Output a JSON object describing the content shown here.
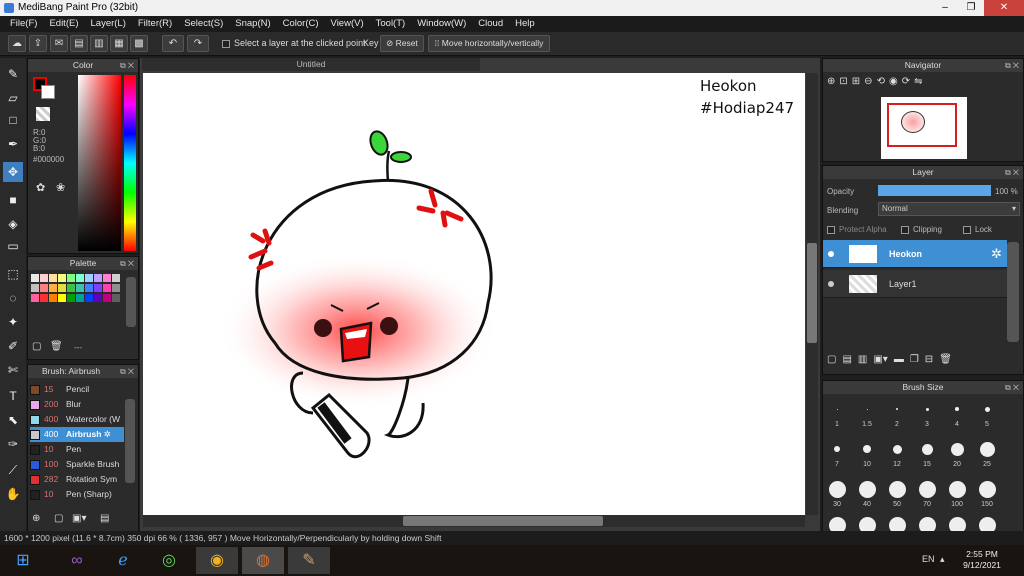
{
  "window": {
    "title": "MediBang Paint Pro (32bit)"
  },
  "menu": [
    "File(F)",
    "Edit(E)",
    "Layer(L)",
    "Filter(R)",
    "Select(S)",
    "Snap(N)",
    "Color(C)",
    "View(V)",
    "Tool(T)",
    "Window(W)",
    "Cloud",
    "Help"
  ],
  "toolbar": {
    "select_layer_label": "Select a layer at the clicked point",
    "key_label": "Key",
    "reset_label": "Reset",
    "move_label": "Move horizontally/vertically"
  },
  "color_panel": {
    "title": "Color",
    "r": "R:0",
    "g": "G:0",
    "b": "B:0",
    "hex": "#000000"
  },
  "palette_panel": {
    "title": "Palette",
    "footer": "---"
  },
  "brush_panel": {
    "title": "Brush: Airbrush",
    "items": [
      {
        "size": "15",
        "name": "Pencil",
        "color": "#7a4a2a"
      },
      {
        "size": "200",
        "name": "Blur",
        "color": "#e8a8e8"
      },
      {
        "size": "400",
        "name": "Watercolor (W",
        "color": "#8ed8e8"
      },
      {
        "size": "400",
        "name": "Airbrush",
        "color": "#c8c8c8",
        "selected": true
      },
      {
        "size": "10",
        "name": "Pen",
        "color": "#222222"
      },
      {
        "size": "100",
        "name": "Sparkle Brush",
        "color": "#2a5adc"
      },
      {
        "size": "282",
        "name": "Rotation Sym",
        "color": "#e03030"
      },
      {
        "size": "10",
        "name": "Pen (Sharp)",
        "color": "#222222"
      }
    ]
  },
  "document": {
    "tab": "Untitled"
  },
  "canvas_text": {
    "line1": "Heokon",
    "line2": "#Hodiap247"
  },
  "navigator": {
    "title": "Navigator"
  },
  "layer_panel": {
    "title": "Layer",
    "opacity_label": "Opacity",
    "opacity_value": "100 %",
    "opacity_fraction": 1.0,
    "blending_label": "Blending",
    "blending_value": "Normal",
    "protect_alpha": "Protect Alpha",
    "clipping": "Clipping",
    "lock": "Lock",
    "layers": [
      {
        "name": "Heokon",
        "selected": true
      },
      {
        "name": "Layer1",
        "selected": false
      }
    ]
  },
  "brush_size_panel": {
    "title": "Brush Size",
    "row1": [
      "1",
      "1.5",
      "2",
      "3",
      "4",
      "5"
    ],
    "row2": [
      "7",
      "10",
      "12",
      "15",
      "20",
      "25"
    ],
    "row3": [
      "30",
      "40",
      "50",
      "70",
      "100",
      "150"
    ]
  },
  "status": {
    "size": "1600 * 1200 pixel",
    "dims": "(11.6 * 8.7cm)",
    "dpi": "350 dpi",
    "zoom": "66 %",
    "coords": "( 1336, 957 )",
    "hint": "Move Horizontally/Perpendicularly by holding down Shift"
  },
  "taskbar": {
    "lang": "EN",
    "time": "2:55 PM",
    "date": "9/12/2021"
  }
}
